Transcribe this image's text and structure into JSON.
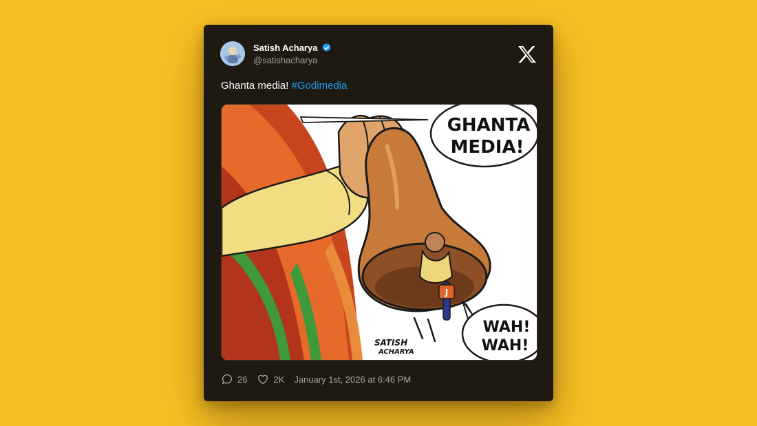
{
  "tweet": {
    "author_name": "Satish Acharya",
    "author_handle": "@satishacharya",
    "text_plain": "Ghanta media!",
    "hashtag": "#Godimedia",
    "replies": "26",
    "likes": "2K",
    "timestamp": "January 1st, 2026 at 6:46 PM"
  },
  "cartoon": {
    "bubble_top_line1": "GHANTA",
    "bubble_top_line2": "MEDIA!",
    "bubble_bottom_line1": "WAH!",
    "bubble_bottom_line2": "WAH!",
    "mic_label": "J",
    "signature_line1": "SATISH",
    "signature_line2": "ACHARYA"
  },
  "colors": {
    "background": "#F7BF24",
    "card": "#1E1A12",
    "hashtag": "#1D9BF0",
    "verified": "#1D9BF0"
  },
  "icons": {
    "verified": "verified-badge-icon",
    "platform": "x-logo-icon",
    "reply": "reply-icon",
    "like": "heart-icon"
  }
}
